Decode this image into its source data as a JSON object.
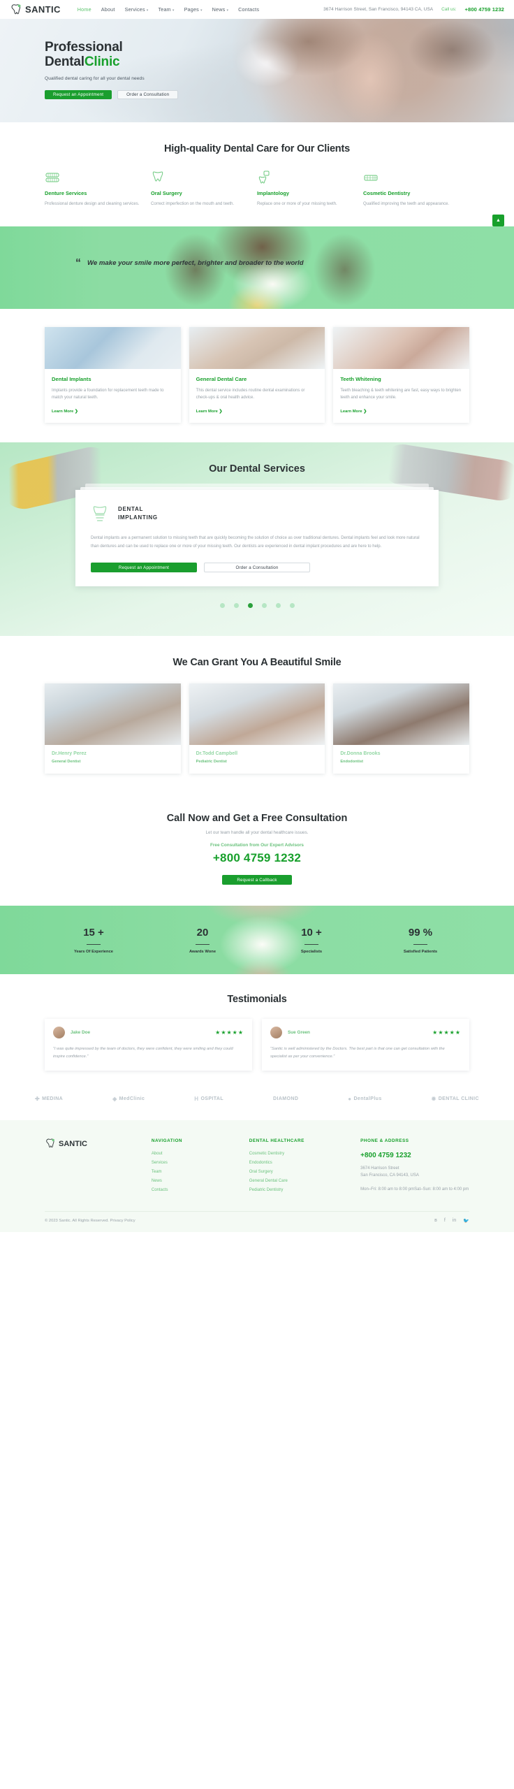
{
  "header": {
    "logo_text": "SANTIC",
    "nav": [
      {
        "label": "Home",
        "active": true,
        "caret": false
      },
      {
        "label": "About",
        "active": false,
        "caret": false
      },
      {
        "label": "Services",
        "active": false,
        "caret": true
      },
      {
        "label": "Team",
        "active": false,
        "caret": true
      },
      {
        "label": "Pages",
        "active": false,
        "caret": true
      },
      {
        "label": "News",
        "active": false,
        "caret": true
      },
      {
        "label": "Contacts",
        "active": false,
        "caret": false
      }
    ],
    "address": "3674 Harrison Street, San Francisco, 94143 CA, USA",
    "call_label": "Call us:",
    "phone": "+800 4759 1232"
  },
  "hero": {
    "title_line1": "Professional",
    "title_line2_dark": "Dental",
    "title_line2_green": "Clinic",
    "subtitle": "Qualified dental caring for all your dental needs",
    "btn_primary": "Request an Appointment",
    "btn_secondary": "Order a Consultation"
  },
  "highquality": {
    "title": "High-quality Dental Care for Our Clients",
    "items": [
      {
        "icon": "dentures-icon",
        "name": "Denture Services",
        "desc": "Professional denture design and cleaning services."
      },
      {
        "icon": "oral-surgery-icon",
        "name": "Oral Surgery",
        "desc": "Correct imperfection on the mouth and teeth."
      },
      {
        "icon": "implant-icon",
        "name": "Implantology",
        "desc": "Replace one or more of your missing teeth."
      },
      {
        "icon": "cosmetic-icon",
        "name": "Cosmetic Dentistry",
        "desc": "Qualified improving the teeth and appearance."
      }
    ],
    "scroll_top_icon": "chevron-up-icon"
  },
  "quote": {
    "mark": "“",
    "text": "We make your smile more perfect, brighter and broader to the world"
  },
  "cards": {
    "items": [
      {
        "title": "Dental Implants",
        "desc": "Implants provide a foundation for replacement teeth made to match your natural teeth.",
        "link": "Learn More"
      },
      {
        "title": "General Dental Care",
        "desc": "This dental service includes routine dental examinations or check-ups & oral health advice.",
        "link": "Learn More"
      },
      {
        "title": "Teeth Whitening",
        "desc": "Teeth bleaching & teeth whitening are fast, easy ways to brighten teeth and enhance your smile.",
        "link": "Learn More"
      }
    ]
  },
  "services": {
    "title": "Our Dental Services",
    "card_icon": "tooth-implant-icon",
    "card_title_line1": "DENTAL",
    "card_title_line2": "IMPLANTING",
    "card_text": "Dental implants are a permanent solution to missing teeth that are quickly becoming the solution of choice as over traditional dentures. Dental implants feel and look more natural than dentures and can be used to replace one or more of your missing teeth. Our dentists are experienced in dental implant procedures and are here to help.",
    "btn_primary": "Request an Appointment",
    "btn_secondary": "Order a Consultation",
    "dots_count": 6,
    "active_dot": 3
  },
  "team": {
    "title": "We Can Grant You A Beautiful Smile",
    "members": [
      {
        "name": "Dr.Henry Perez",
        "role": "General Dentist"
      },
      {
        "name": "Dr.Todd Campbell",
        "role": "Pediatric Dentist"
      },
      {
        "name": "Dr.Donna Brooks",
        "role": "Endodontist"
      }
    ]
  },
  "callnow": {
    "title": "Call Now and Get a Free Consultation",
    "subtitle": "Let our team handle all your dental healthcare issues.",
    "expert_line": "Free Consultation from Our Expert Advisors",
    "phone": "+800 4759 1232",
    "button": "Request a Callback"
  },
  "stats": [
    {
      "value": "15 +",
      "label": "Years Of Experience"
    },
    {
      "value": "20",
      "label": "Awards Wone"
    },
    {
      "value": "10 +",
      "label": "Specialists"
    },
    {
      "value": "99 %",
      "label": "Satisfied Patients"
    }
  ],
  "testimonials": {
    "title": "Testimonials",
    "items": [
      {
        "name": "Jake Doe",
        "stars": "★★★★★",
        "quote": "“I was quite impressed by the team of doctors, they were confident, they were smiling and they could inspire confidence.”"
      },
      {
        "name": "Sue Green",
        "stars": "★★★★★",
        "quote": "“Santic is well administered by the Doctors. The best part is that one can get consultation with the specialist as per your convenience.”"
      }
    ]
  },
  "brands": [
    {
      "mark": "✚",
      "name": "MEDINA"
    },
    {
      "mark": "◈",
      "name": "MedClinic"
    },
    {
      "mark": "H",
      "name": "OSPITAL"
    },
    {
      "mark": "",
      "name": "DIAMOND"
    },
    {
      "mark": "●",
      "name": "DentalPlus"
    },
    {
      "mark": "✹",
      "name": "DENTAL CLINIC"
    }
  ],
  "footer": {
    "logo_text": "SANTIC",
    "nav_head": "NAVIGATION",
    "nav_links": [
      "About",
      "Services",
      "Team",
      "News",
      "Contacts"
    ],
    "health_head": "DENTAL HEALTHCARE",
    "health_links": [
      "Cosmetic Dentistry",
      "Endodontics",
      "Oral Surgery",
      "General Dental Care",
      "Pediatric Dentistry"
    ],
    "contact_head": "PHONE & ADDRESS",
    "phone": "+800 4759 1232",
    "address_line1": "3674 Harrison Street",
    "address_line2": "San Francisco, CA 94143, USA",
    "hours": "Mon–Fri: 8:00 am to 8:00 pmSat–Sun: 8:00 am to 4:00 pm",
    "copyright": "© 2023 Santic. All Rights Reserved. Privacy Policy",
    "social": [
      "behance-icon",
      "facebook-icon",
      "linkedin-icon",
      "twitter-icon"
    ]
  }
}
